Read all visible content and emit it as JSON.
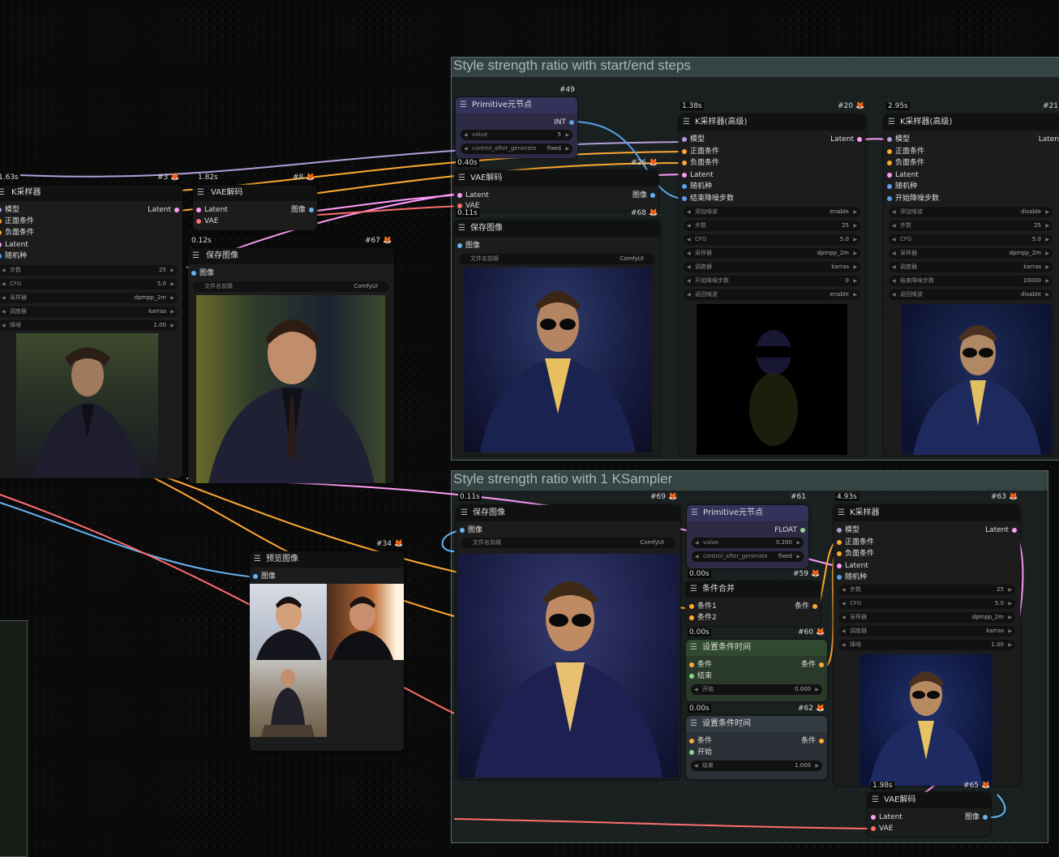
{
  "groups": {
    "g1_title": "Style strength ratio with start/end steps",
    "g2_title": "Style strength ratio with 1 KSampler"
  },
  "colors": {
    "lat": "#ff9cf9",
    "img": "#64b5f6",
    "model": "#b39ddb",
    "cond": "#ffa931",
    "vae": "#ff6e6e",
    "fox": "#ff7a2c"
  },
  "icons": {
    "menu": "menu-icon",
    "fox": "fox-icon"
  },
  "n3": {
    "time": "1.63s",
    "id": "#3",
    "title": "K采样器",
    "in": [
      "模型",
      "正面条件",
      "负面条件",
      "Latent",
      "随机种"
    ],
    "out": "Latent",
    "w": [
      [
        "步数",
        "25"
      ],
      [
        "CFG",
        "5.0"
      ],
      [
        "采样器",
        "dpmpp_2m"
      ],
      [
        "调度器",
        "karras"
      ],
      [
        "降噪",
        "1.00"
      ]
    ]
  },
  "n8": {
    "time": "1.82s",
    "id": "#8",
    "title": "VAE解码",
    "in": [
      "Latent",
      "VAE"
    ],
    "out": "图像"
  },
  "n67": {
    "time": "0.12s",
    "id": "#67",
    "title": "保存图像",
    "in": "图像",
    "w_label": "文件名前缀",
    "w_val": "ComfyUI"
  },
  "n49": {
    "id": "#49",
    "title": "Primitive元节点",
    "out": "INT",
    "w": [
      [
        "value",
        "5"
      ],
      [
        "control_after_generate",
        "fixed"
      ]
    ]
  },
  "n26": {
    "time": "0.40s",
    "id": "#26",
    "title": "VAE解码",
    "in": [
      "Latent",
      "VAE"
    ],
    "out": "图像"
  },
  "n68": {
    "time": "0.11s",
    "id": "#68",
    "title": "保存图像",
    "in": "图像",
    "w_label": "文件名前缀",
    "w_val": "ComfyUI"
  },
  "n20": {
    "time": "1.38s",
    "id": "#20",
    "title": "K采样器(高级)",
    "in": [
      "模型",
      "正面条件",
      "负面条件",
      "Latent",
      "随机种",
      "结束降噪步数"
    ],
    "out": "Latent",
    "w": [
      [
        "添加噪波",
        "enable"
      ],
      [
        "步数",
        "25"
      ],
      [
        "CFG",
        "5.0"
      ],
      [
        "采样器",
        "dpmpp_2m"
      ],
      [
        "调度器",
        "karras"
      ],
      [
        "开始降噪步数",
        "0"
      ],
      [
        "返回噪波",
        "enable"
      ]
    ]
  },
  "n21": {
    "time": "2.95s",
    "id": "#21",
    "title": "K采样器(高级)",
    "in": [
      "模型",
      "正面条件",
      "负面条件",
      "Latent",
      "随机种",
      "开始降噪步数"
    ],
    "out": "Laten",
    "w": [
      [
        "添加噪波",
        "disable"
      ],
      [
        "步数",
        "25"
      ],
      [
        "CFG",
        "5.0"
      ],
      [
        "采样器",
        "dpmpp_2m"
      ],
      [
        "调度器",
        "karras"
      ],
      [
        "结束降噪步数",
        "10000"
      ],
      [
        "返回噪波",
        "disable"
      ]
    ]
  },
  "n69": {
    "time": "0.11s",
    "id": "#69",
    "title": "保存图像",
    "in": "图像",
    "w_label": "文件名前缀",
    "w_val": "ComfyUI"
  },
  "n61": {
    "id": "#61",
    "title": "Primitive元节点",
    "out": "FLOAT",
    "w": [
      [
        "value",
        "0.200"
      ],
      [
        "control_after_generate",
        "fixed"
      ]
    ]
  },
  "n59": {
    "time": "0.00s",
    "id": "#59",
    "title": "条件合并",
    "in": [
      "条件1",
      "条件2"
    ],
    "out": "条件"
  },
  "n60": {
    "time": "0.00s",
    "id": "#60",
    "title": "设置条件时间",
    "in": [
      "条件",
      "结束"
    ],
    "out": "条件",
    "w": [
      [
        "开始",
        "0.000"
      ]
    ]
  },
  "n62": {
    "time": "0.00s",
    "id": "#62",
    "title": "设置条件时间",
    "in": [
      "条件",
      "开始"
    ],
    "out": "条件",
    "w": [
      [
        "结束",
        "1.000"
      ]
    ]
  },
  "n63": {
    "time": "4.93s",
    "id": "#63",
    "title": "K采样器",
    "in": [
      "模型",
      "正面条件",
      "负面条件",
      "Latent",
      "随机种"
    ],
    "out": "Latent",
    "w": [
      [
        "步数",
        "25"
      ],
      [
        "CFG",
        "5.0"
      ],
      [
        "采样器",
        "dpmpp_2m"
      ],
      [
        "调度器",
        "karras"
      ],
      [
        "降噪",
        "1.00"
      ]
    ]
  },
  "n65": {
    "time": "1.98s",
    "id": "#65",
    "title": "VAE解码",
    "in": [
      "Latent",
      "VAE"
    ],
    "out": "图像"
  },
  "n34": {
    "id": "#34",
    "title": "预览图像",
    "in": "图像"
  }
}
